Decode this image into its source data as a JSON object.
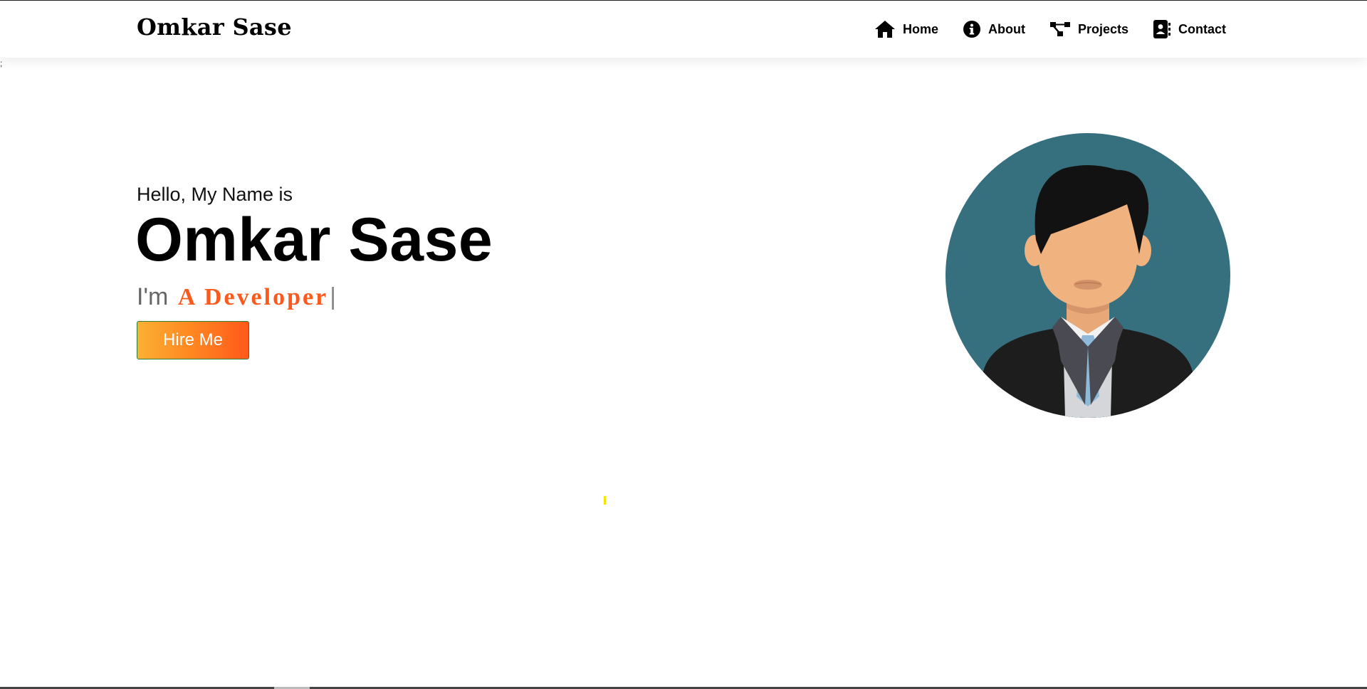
{
  "brand": {
    "name": "Omkar Sase"
  },
  "nav": {
    "items": [
      {
        "label": "Home",
        "icon": "home-icon"
      },
      {
        "label": "About",
        "icon": "info-icon"
      },
      {
        "label": "Projects",
        "icon": "project-diagram-icon"
      },
      {
        "label": "Contact",
        "icon": "address-book-icon"
      }
    ]
  },
  "stray_text": ";",
  "hero": {
    "greeting": "Hello, My Name is",
    "name": "Omkar Sase",
    "role_prefix": "I'm",
    "role_typed": "A Developer",
    "typing_cursor": "|",
    "cta_label": "Hire Me",
    "avatar_icon": "businessman-avatar",
    "colors": {
      "accent": "#fc5a1c",
      "button_gradient_start": "#fbb034",
      "button_gradient_end": "#ff5a1a",
      "avatar_background": "#36707f"
    }
  }
}
